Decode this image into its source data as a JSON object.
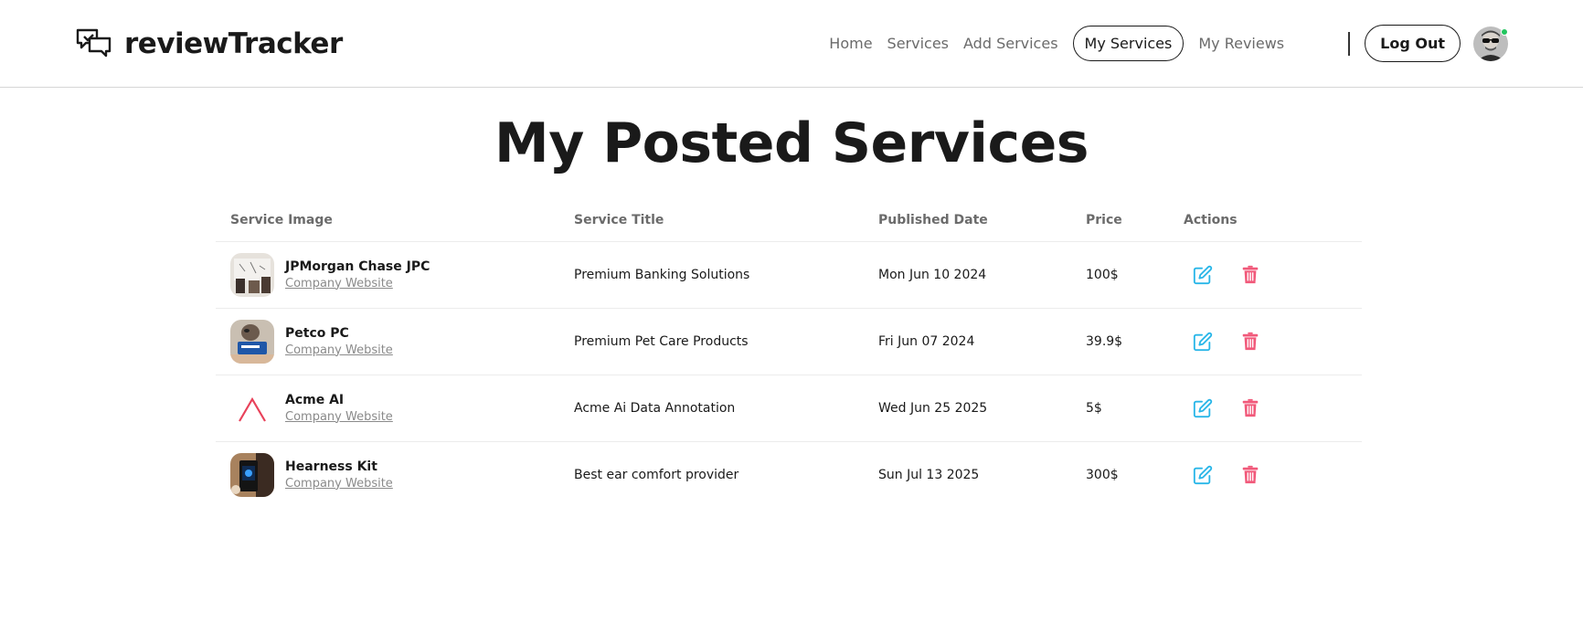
{
  "brand": {
    "name": "reviewTracker"
  },
  "nav": {
    "links": [
      {
        "label": "Home"
      },
      {
        "label": "Services"
      },
      {
        "label": "Add Services"
      },
      {
        "label": "My Services",
        "active": true
      },
      {
        "label": "My Reviews"
      }
    ],
    "logout_label": "Log Out"
  },
  "page": {
    "title": "My Posted Services"
  },
  "table": {
    "headers": {
      "image": "Service Image",
      "title": "Service Title",
      "date": "Published Date",
      "price": "Price",
      "actions": "Actions"
    },
    "rows": [
      {
        "company": "JPMorgan Chase JPC",
        "link": "Company Website",
        "title": "Premium Banking Solutions",
        "date": "Mon Jun 10 2024",
        "price": "100$"
      },
      {
        "company": "Petco PC",
        "link": "Company Website",
        "title": "Premium Pet Care Products",
        "date": "Fri Jun 07 2024",
        "price": "39.9$"
      },
      {
        "company": "Acme AI",
        "link": "Company Website",
        "title": "Acme Ai Data Annotation",
        "date": "Wed Jun 25 2025",
        "price": "5$"
      },
      {
        "company": "Hearness Kit",
        "link": "Company Website",
        "title": "Best ear comfort provider",
        "date": "Sun Jul 13 2025",
        "price": "300$"
      }
    ]
  },
  "colors": {
    "edit": "#29b6e8",
    "delete": "#f1597a",
    "online": "#22c55e"
  }
}
